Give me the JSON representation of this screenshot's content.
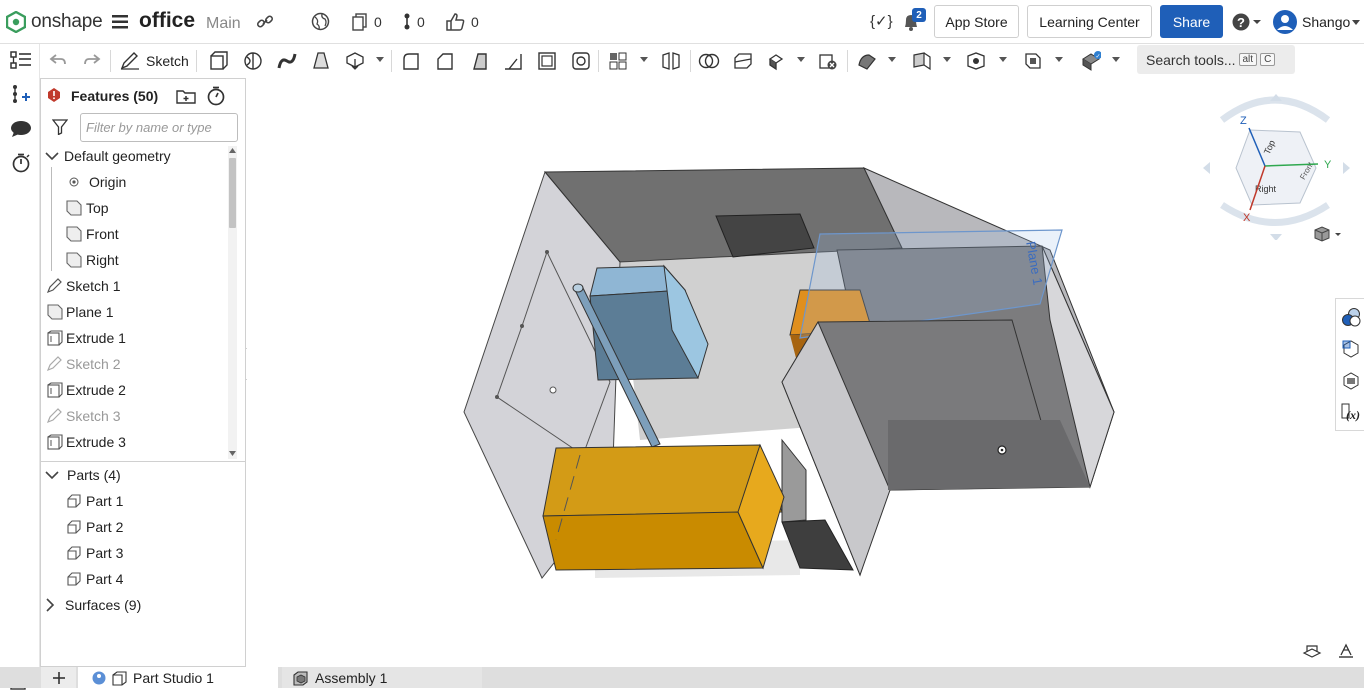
{
  "header": {
    "logo_text": "onshape",
    "document_name": "office",
    "workspace": "Main",
    "versions_count": "0",
    "branches_count": "0",
    "likes_count": "0",
    "notifications_count": "2",
    "app_store_label": "App Store",
    "learning_center_label": "Learning Center",
    "share_label": "Share",
    "user_name": "Shango",
    "variable_label": "{✓}"
  },
  "toolbar": {
    "sketch_label": "Sketch",
    "search_label": "Search tools...",
    "search_shortcut_1": "alt",
    "search_shortcut_2": "C"
  },
  "features_panel": {
    "title": "Features (50)",
    "filter_placeholder": "Filter by name or type",
    "default_geometry_label": "Default geometry",
    "default_items": [
      "Origin",
      "Top",
      "Front",
      "Right"
    ],
    "feature_items": [
      {
        "label": "Sketch 1",
        "suppressed": false
      },
      {
        "label": "Plane 1",
        "suppressed": false
      },
      {
        "label": "Extrude 1",
        "suppressed": false
      },
      {
        "label": "Sketch 2",
        "suppressed": true
      },
      {
        "label": "Extrude 2",
        "suppressed": false
      },
      {
        "label": "Sketch 3",
        "suppressed": true
      },
      {
        "label": "Extrude 3",
        "suppressed": false
      }
    ],
    "parts_label": "Parts (4)",
    "parts": [
      "Part 1",
      "Part 2",
      "Part 3",
      "Part 4"
    ],
    "surfaces_label": "Surfaces (9)"
  },
  "viewport": {
    "plane_label": "Plane 1",
    "view_cube_labels": {
      "top": "Top",
      "right": "Right",
      "front": "Front"
    },
    "axis_labels": {
      "x": "X",
      "y": "Y",
      "z": "Z"
    }
  },
  "tabs": [
    {
      "label": "Part Studio 1",
      "active": true
    },
    {
      "label": "Assembly 1",
      "active": false
    }
  ],
  "colors": {
    "brand_blue": "#1f5fb8",
    "part_orange": "#e0a000",
    "part_blue": "#7fb6d8",
    "surface_gray": "#6e6e6e",
    "axis_x": "#c0392b",
    "axis_y": "#2fa84f",
    "axis_z": "#1f5fb8"
  }
}
